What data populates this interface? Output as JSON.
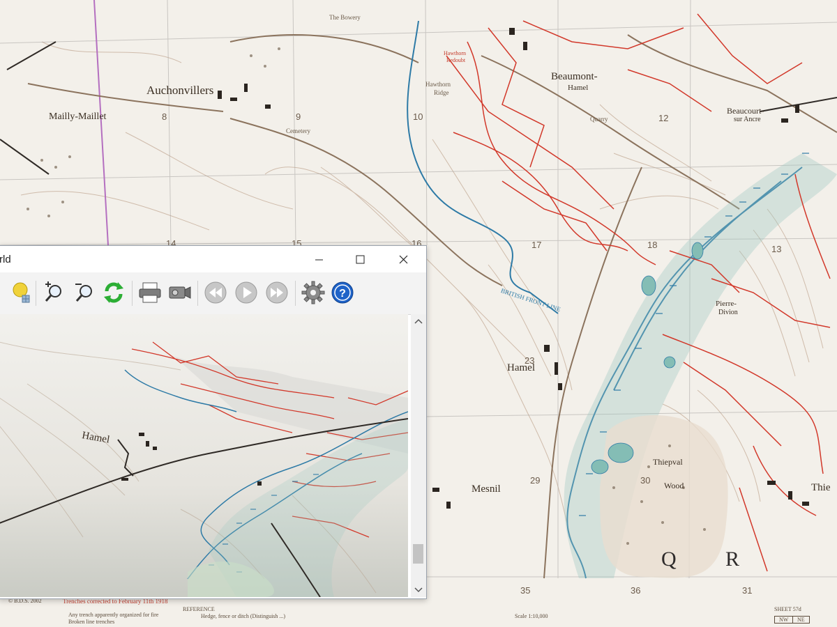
{
  "map": {
    "labels": {
      "auchonvillers": "Auchonvillers",
      "mailly_maillet": "Mailly-Maillet",
      "beaumont": "Beaumont-",
      "hamel_top": "Hamel",
      "beaucourt": "Beaucourt-",
      "beaucourt_2": "sur Ancre",
      "hamel": "Hamel",
      "mesnil": "Mesnil",
      "thiepval": "Thiepval",
      "wood": "Wood",
      "pierre": "Pierre-",
      "divion": "Divion",
      "thie": "Thie",
      "hawthorn_ridge": "Hawthorn",
      "hawthorn_ridge_2": "Ridge",
      "hawthorn_redoubt": "Hawthorn",
      "hawthorn_redoubt_2": "Redoubt",
      "the_bowery": "The Bowery",
      "cemetery": "Cemetery",
      "quarry": "Quarry",
      "british_front_line": "BRITISH FRONT LINE",
      "thiepval_wood": "thiepval Wood"
    },
    "grid_numbers": [
      "8",
      "9",
      "10",
      "12",
      "13",
      "14",
      "15",
      "16",
      "17",
      "18",
      "23",
      "29",
      "30",
      "35",
      "36",
      "31"
    ],
    "sheet_letters": [
      "Q",
      "R"
    ]
  },
  "viewer": {
    "title": "rld",
    "toolbar": {
      "icons": [
        "light-bulb-icon",
        "zoom-in-icon",
        "zoom-out-icon",
        "refresh-icon",
        "print-icon",
        "camera-icon",
        "rewind-icon",
        "play-icon",
        "fast-forward-icon",
        "settings-gear-icon",
        "help-icon"
      ]
    },
    "scene_labels": {
      "hamel": "Hamel"
    },
    "scroll_position": 0.88
  },
  "legend": {
    "copyright": "© B.D.S. 2002",
    "trenches": "Trenches corrected to February 11th 1918",
    "reference": "REFERENCE",
    "line1": "Any trench apparently organized for fire",
    "line2": "Broken line trenches",
    "line3": "Hedge, fence or ditch (Distinguish ...)",
    "scale": "Scale 1:10,000",
    "sheet": "SHEET 57d",
    "nw": "NW",
    "ne": "NE"
  },
  "colors": {
    "paper": "#f4f1ec",
    "trench_red": "#d2382a",
    "river_blue": "#2d7aa6",
    "contour_brown": "#b79a83",
    "grid_purple": "#b46fc0"
  }
}
